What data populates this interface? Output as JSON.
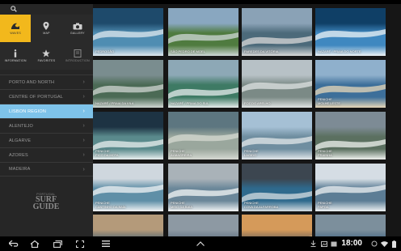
{
  "sidebar": {
    "tiles": [
      {
        "label": "WAVES",
        "icon": "wave-icon",
        "active": true
      },
      {
        "label": "MAP",
        "icon": "map-pin-icon",
        "active": false
      },
      {
        "label": "GALLERY",
        "icon": "camera-icon",
        "active": false
      },
      {
        "label": "INFORMATION",
        "icon": "info-icon",
        "active": false
      },
      {
        "label": "FAVORITES",
        "icon": "star-icon",
        "active": false
      },
      {
        "label": "INTRODUCTION",
        "icon": "book-icon",
        "active": false
      }
    ],
    "regions": [
      {
        "label": "PORTO AND NORTH"
      },
      {
        "label": "CENTRE OF PORTUGAL"
      },
      {
        "label": "LISBON REGION",
        "active": true
      },
      {
        "label": "ALENTEJO"
      },
      {
        "label": "ALGARVE"
      },
      {
        "label": "AZORES"
      },
      {
        "label": "MADEIRA"
      }
    ],
    "logo": {
      "line1": "PORTUGAL",
      "line2": "SURF",
      "line3": "GUIDE"
    }
  },
  "grid": {
    "spots": [
      {
        "region": "",
        "name": "PEDROGÃO"
      },
      {
        "region": "",
        "name": "SÃO PEDRO DE MOEL"
      },
      {
        "region": "",
        "name": "PAREDES DA VITÓRIA"
      },
      {
        "region": "",
        "name": "NAZARÉ / PRAIA DO NORTE"
      },
      {
        "region": "",
        "name": "NAZARÉ / PRAIA DA VILA"
      },
      {
        "region": "",
        "name": "NAZARÉ / PRAIA DO SUL"
      },
      {
        "region": "",
        "name": "FOZ DO ARELHO"
      },
      {
        "region": "PENICHE",
        "name": "MOLHE LESTE"
      },
      {
        "region": "PENICHE",
        "name": "PICO DA MOTA"
      },
      {
        "region": "PENICHE",
        "name": "ALMAGREIRA"
      },
      {
        "region": "PENICHE",
        "name": "LAGIDO"
      },
      {
        "region": "PENICHE",
        "name": "PRAINHA"
      },
      {
        "region": "PENICHE",
        "name": "CANTINHO DA BAÍA"
      },
      {
        "region": "PENICHE",
        "name": "MEIO DA BAÍA"
      },
      {
        "region": "PENICHE",
        "name": "COVA DA ALFARROBA"
      },
      {
        "region": "PENICHE",
        "name": "PAPOA"
      },
      {
        "region": "",
        "name": ""
      },
      {
        "region": "",
        "name": ""
      },
      {
        "region": "",
        "name": ""
      },
      {
        "region": "",
        "name": ""
      }
    ]
  },
  "statusbar": {
    "time": "18:00"
  },
  "navbar": {
    "back": "back-icon",
    "home": "home-icon",
    "recents": "recent-apps-icon",
    "screenshot": "screenshot-icon",
    "menu": "menu-icon",
    "up": "chevron-up-icon"
  }
}
